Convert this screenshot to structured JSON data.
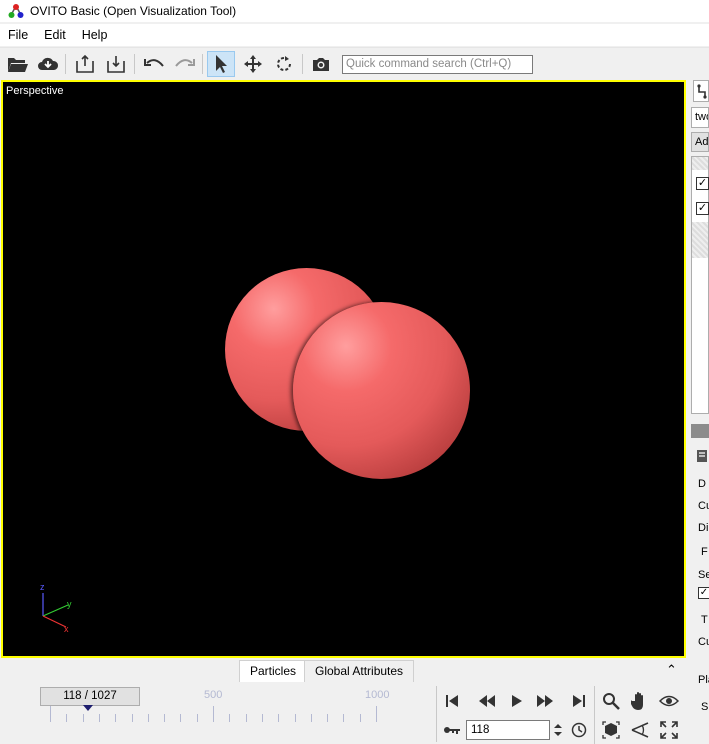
{
  "window": {
    "title": "OVITO Basic (Open Visualization Tool)"
  },
  "menu": {
    "items": [
      "File",
      "Edit",
      "Help"
    ]
  },
  "toolbar": {
    "buttons": [
      "open-file",
      "load-remote",
      "import",
      "export",
      "undo",
      "redo",
      "select-mode",
      "move-mode",
      "rotate-mode",
      "render"
    ],
    "search_placeholder": "Quick command search (Ctrl+Q)"
  },
  "viewport": {
    "caption": "Perspective",
    "border_color": "#ffff00",
    "sphere_color": "#f06464"
  },
  "axis_tripod": {
    "z": "z",
    "y": "y",
    "x": "x"
  },
  "right_panel": {
    "item1": "two",
    "item2": "Ad"
  },
  "data_tabs": {
    "tab1": "Particles",
    "tab2": "Global Attributes"
  },
  "timeline": {
    "current": "118 / 1027",
    "label_500": "500",
    "label_1000": "1000",
    "current_frame": 118,
    "max_frame": 1027
  },
  "animation": {
    "frame_value": "118"
  }
}
